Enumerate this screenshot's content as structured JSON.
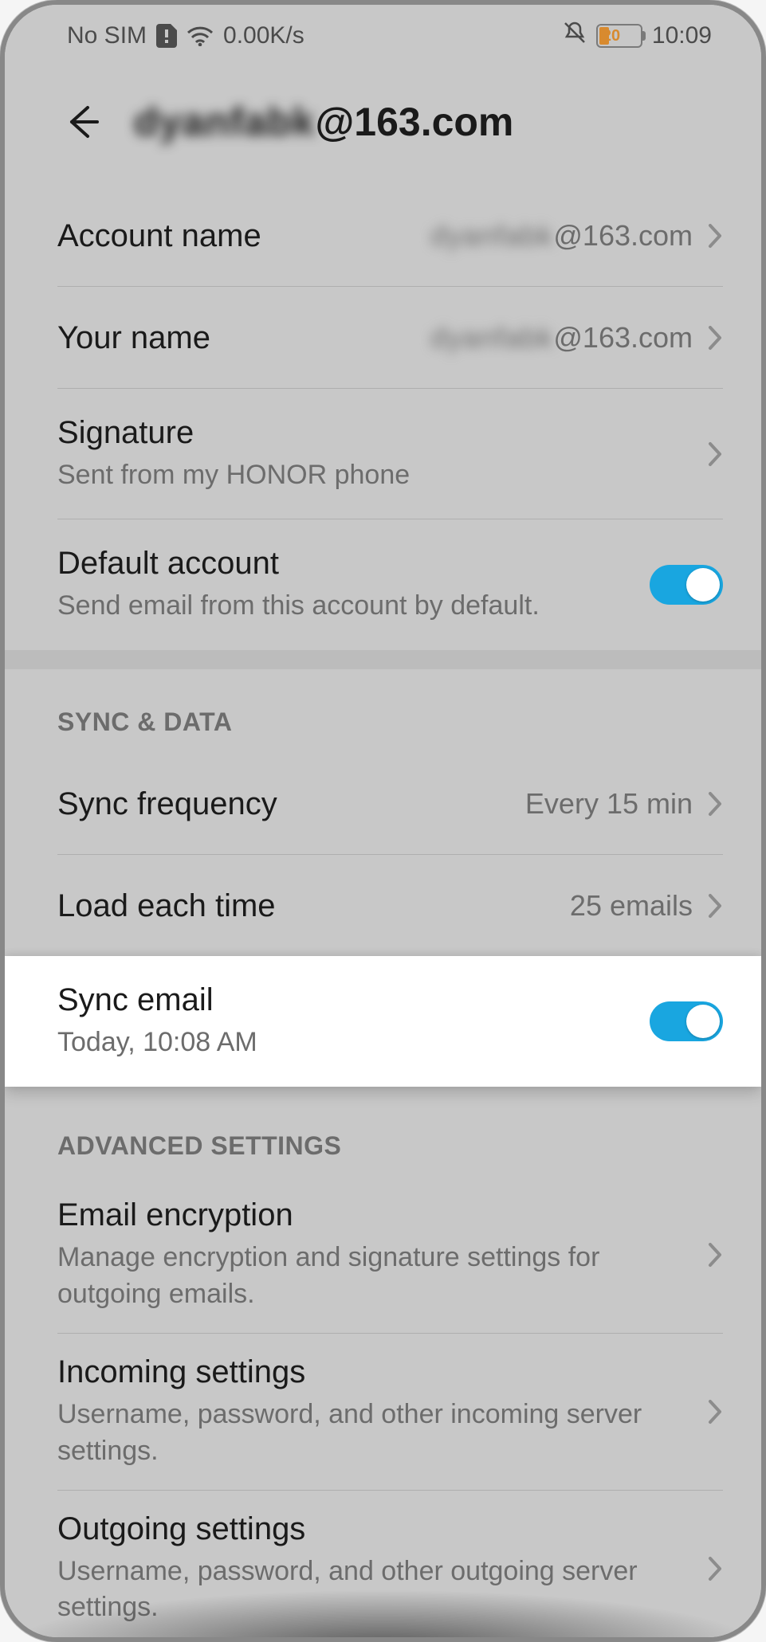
{
  "status": {
    "sim": "No SIM",
    "data_rate": "0.00K/s",
    "battery_pct": "20",
    "time": "10:09"
  },
  "header": {
    "email_obscured": "dyanfabk",
    "email_domain": "@163.com"
  },
  "account": {
    "account_name": {
      "label": "Account name",
      "value_obscured": "dyanfabk",
      "value_domain": "@163.com"
    },
    "your_name": {
      "label": "Your name",
      "value_obscured": "dyanfabk",
      "value_domain": "@163.com"
    },
    "signature": {
      "label": "Signature",
      "sub": "Sent from my HONOR phone"
    },
    "default_account": {
      "label": "Default account",
      "sub": "Send email from this account by default."
    }
  },
  "sync": {
    "section": "SYNC & DATA",
    "frequency": {
      "label": "Sync frequency",
      "value": "Every 15 min"
    },
    "load": {
      "label": "Load each time",
      "value": "25 emails"
    },
    "sync_email": {
      "label": "Sync email",
      "sub": "Today, 10:08 AM"
    }
  },
  "advanced": {
    "section": "ADVANCED SETTINGS",
    "encryption": {
      "label": "Email encryption",
      "sub": "Manage encryption and signature settings for outgoing emails."
    },
    "incoming": {
      "label": "Incoming settings",
      "sub": "Username, password, and other incoming server settings."
    },
    "outgoing": {
      "label": "Outgoing settings",
      "sub": "Username, password, and other outgoing server settings."
    }
  }
}
